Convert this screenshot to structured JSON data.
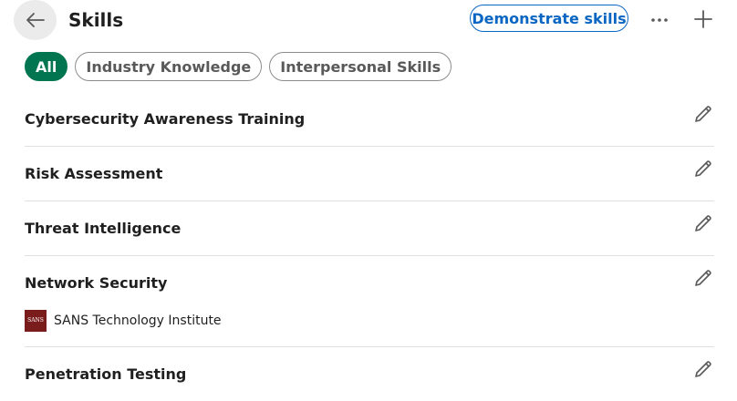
{
  "header": {
    "title": "Skills",
    "demonstrate_label": "Demonstrate skills",
    "back_icon": "arrow-left-icon",
    "more_icon": "ellipsis-icon",
    "add_icon": "plus-icon"
  },
  "filters": [
    {
      "label": "All",
      "active": true
    },
    {
      "label": "Industry Knowledge",
      "active": false
    },
    {
      "label": "Interpersonal Skills",
      "active": false
    }
  ],
  "skills": [
    {
      "name": "Cybersecurity Awareness Training"
    },
    {
      "name": "Risk Assessment"
    },
    {
      "name": "Threat Intelligence"
    },
    {
      "name": "Network Security",
      "association": "SANS Technology Institute",
      "association_logo_text": "SANS"
    },
    {
      "name": "Penetration Testing"
    }
  ],
  "colors": {
    "accent_blue": "#0a66c2",
    "active_filter_green": "#01754f",
    "divider": "#e0e0e0",
    "sans_logo_bg": "#7a1c1c"
  }
}
